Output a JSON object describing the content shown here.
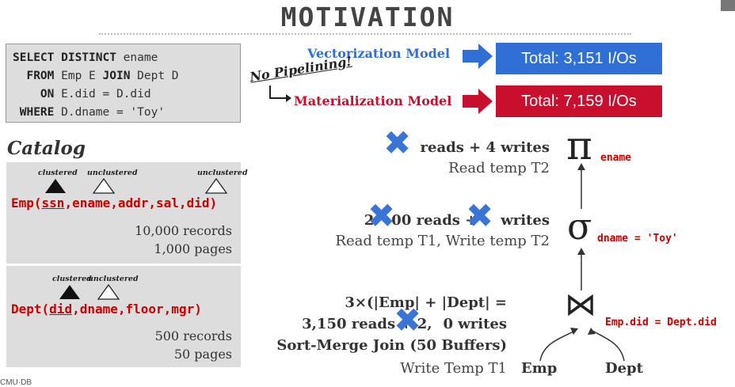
{
  "slide": {
    "title": "MOTIVATION",
    "footer": "CMU·DB"
  },
  "sql": {
    "line1_kw": "SELECT DISTINCT",
    "line1_rest": " ename",
    "line2_kw": "  FROM",
    "line2_mid": " Emp E ",
    "line2_kw2": "JOIN",
    "line2_rest": " Dept D",
    "line3_kw": "    ON",
    "line3_rest": " E.did = D.did",
    "line4_kw": " WHERE",
    "line4_rest": " D.dname = 'Toy'"
  },
  "models": {
    "vectorization_label": "Vectorization Model",
    "vectorization_total": "Total: 3,151 I/Os",
    "materialization_label": "Materialization Model",
    "materialization_total": "Total: 7,159 I/Os",
    "no_pipelining": "No Pipelining!",
    "colors": {
      "blue": "#2f6fd6",
      "red": "#c8102e"
    }
  },
  "catalog": {
    "title": "Catalog",
    "emp": {
      "name": "Emp(",
      "key": "ssn",
      "rest": ",ename,addr,sal,did)",
      "idx1": "clustered",
      "idx2": "unclustered",
      "idx3": "unclustered",
      "records": "10,000 records",
      "pages": "1,000 pages"
    },
    "dept": {
      "name": "Dept(",
      "key": "did",
      "rest": ",dname,floor,mgr)",
      "idx1": "clustered",
      "idx2": "unclustered",
      "records": "500 records",
      "pages": "50 pages"
    }
  },
  "plan": {
    "proj_cost_a": "reads + 4 writes",
    "proj_cost_b": "Read temp T2",
    "proj_expr": "ename",
    "sel_cost_a1": "2",
    "sel_cost_a2": "00 reads +",
    "sel_cost_a3": "writes",
    "sel_cost_b": "Read temp T1, Write temp T2",
    "sel_expr": "dname = 'Toy'",
    "join_cost_a": "3×(|Emp| + |Dept| =",
    "join_cost_b1": "3,150 reads + 2,",
    "join_cost_b2": "0 writes",
    "join_cost_c": "Sort-Merge Join (50 Buffers)",
    "join_cost_d": "Write Temp T1",
    "join_expr": "Emp.did = Dept.did",
    "leaf_left": "Emp",
    "leaf_right": "Dept",
    "proj_symbol": "π",
    "sel_symbol": "σ",
    "join_symbol": "⋈"
  }
}
